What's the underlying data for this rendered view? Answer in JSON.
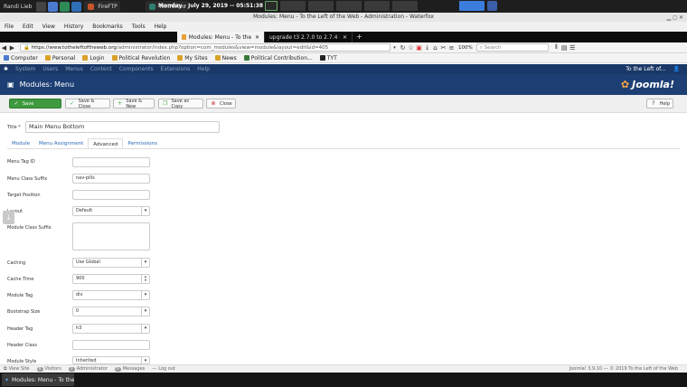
{
  "taskbar": {
    "user": "Randi Lieb",
    "apps": [
      {
        "label": "FireFTP",
        "color": "#c7552a"
      },
      {
        "label": "TextNotes",
        "color": "#2d7d6f"
      }
    ],
    "clock": "Monday - July 29, 2019 -- 05:51:38 AM"
  },
  "window": {
    "title": "Modules: Menu - To the Left of the Web - Administration - Waterfox"
  },
  "menubar": [
    "File",
    "Edit",
    "View",
    "History",
    "Bookmarks",
    "Tools",
    "Help"
  ],
  "tabs": [
    {
      "label": "Modules: Menu - To the Left o",
      "active": true
    },
    {
      "label": "upgrade t3 2.7.0 to 2.7.4 messa",
      "active": false
    }
  ],
  "nav": {
    "url_host": "https://www.totheleftoftheweb.org",
    "url_path": "/administrator/index.php?option=com_modules&view=module&layout=edit&id=405",
    "zoom": "100%",
    "search_placeholder": "Search"
  },
  "bookmarks": [
    {
      "label": "Computer",
      "color": "#4a7bd0"
    },
    {
      "label": "Personal",
      "color": "#d9a12b"
    },
    {
      "label": "Login",
      "color": "#d9a12b"
    },
    {
      "label": "Political Revolution",
      "color": "#d9a12b"
    },
    {
      "label": "My Sites",
      "color": "#d9a12b"
    },
    {
      "label": "News",
      "color": "#d9a12b"
    },
    {
      "label": "Political Contribution...",
      "color": "#3a7a3a"
    },
    {
      "label": "TYT",
      "color": "#222222"
    }
  ],
  "joomla_top": {
    "items": [
      "System",
      "Users",
      "Menus",
      "Content",
      "Components",
      "Extensions",
      "Help"
    ],
    "site_link": "To the Left of..."
  },
  "header": {
    "title": "Modules: Menu",
    "brand": "Joomla!"
  },
  "toolbar": {
    "save": "Save",
    "save_close": "Save & Close",
    "save_new": "Save & New",
    "save_copy": "Save as Copy",
    "close": "Close",
    "help": "Help"
  },
  "form": {
    "title_label": "Title *",
    "title_value": "Main Menu Bottom",
    "tabs": [
      "Module",
      "Menu Assignment",
      "Advanced",
      "Permissions"
    ],
    "active_tab": "Advanced",
    "fields": {
      "menu_tag_id": {
        "label": "Menu Tag ID",
        "value": ""
      },
      "menu_class_suffix": {
        "label": "Menu Class Suffix",
        "value": "nav-pills"
      },
      "target_position": {
        "label": "Target Position",
        "value": ""
      },
      "layout": {
        "label": "Layout",
        "value": "Default"
      },
      "module_class_suffix": {
        "label": "Module Class Suffix",
        "value": ""
      },
      "caching": {
        "label": "Caching",
        "value": "Use Global"
      },
      "cache_time": {
        "label": "Cache Time",
        "value": "900"
      },
      "module_tag": {
        "label": "Module Tag",
        "value": "div"
      },
      "bootstrap_size": {
        "label": "Bootstrap Size",
        "value": "0"
      },
      "header_tag": {
        "label": "Header Tag",
        "value": "h3"
      },
      "header_class": {
        "label": "Header Class",
        "value": ""
      },
      "module_style": {
        "label": "Module Style",
        "value": "Inherited"
      }
    }
  },
  "status": {
    "view_site": "View Site",
    "visitors_count": "0",
    "visitors": "Visitors",
    "admin_count": "1",
    "administrator": "Administrator",
    "messages_count": "0",
    "messages": "Messages",
    "logout": "Log out",
    "version": "Joomla! 3.9.10 — © 2019 To the Left of the Web"
  },
  "bottom_task": "Modules: Menu - To the..."
}
